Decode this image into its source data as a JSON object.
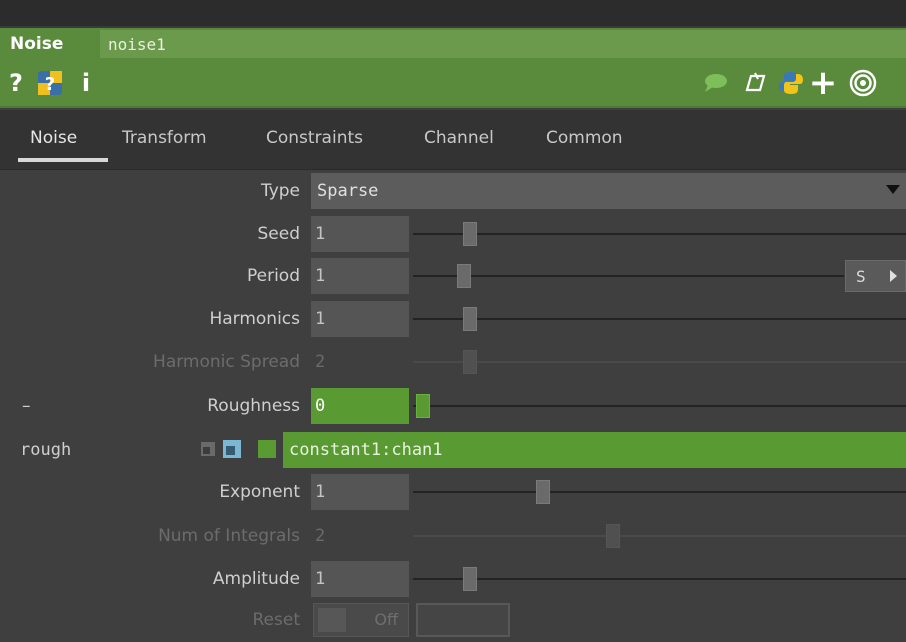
{
  "header": {
    "op_type": "Noise",
    "op_name": "noise1"
  },
  "tabs": [
    {
      "label": "Noise",
      "active": true
    },
    {
      "label": "Transform"
    },
    {
      "label": "Constraints"
    },
    {
      "label": "Channel"
    },
    {
      "label": "Common"
    }
  ],
  "params": {
    "type": {
      "label": "Type",
      "value": "Sparse"
    },
    "seed": {
      "label": "Seed",
      "value": "1",
      "level": 0.1
    },
    "period": {
      "label": "Period",
      "value": "1",
      "level": 0.09,
      "button": "S"
    },
    "harmonics": {
      "label": "Harmonics",
      "value": "1",
      "level": 0.1
    },
    "harmonic_spread": {
      "label": "Harmonic Spread",
      "value": "2",
      "level": 0.1
    },
    "roughness": {
      "label": "Roughness",
      "value": "0",
      "collapse": "–",
      "level": 0.0
    },
    "rough_expr": {
      "label": "rough",
      "expression": "constant1:chan1"
    },
    "exponent": {
      "label": "Exponent",
      "value": "1",
      "level": 0.25
    },
    "num_integrals": {
      "label": "Num of Integrals",
      "value": "2",
      "level": 0.4
    },
    "amplitude": {
      "label": "Amplitude",
      "value": "1",
      "level": 0.1
    },
    "reset": {
      "label": "Reset",
      "value": "Off"
    }
  },
  "icons": [
    "help-icon",
    "python-help-icon",
    "info-icon",
    "comment-icon",
    "clone-icon",
    "python-icon",
    "add-icon",
    "viewer-icon"
  ],
  "colors": {
    "accent_green": "#5a8a3c",
    "expr_green": "#5a9a32",
    "bg": "#3f3f3f"
  }
}
